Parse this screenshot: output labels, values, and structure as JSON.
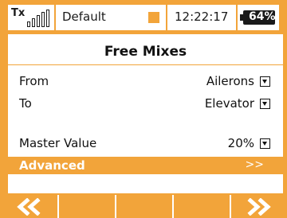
{
  "status_bar": {
    "tx_label": "Tx",
    "signal_icon": "signal-strength-icon",
    "model_name": "Default",
    "time": "12:22:17",
    "battery_percent": "64%",
    "battery_icon": "battery-icon"
  },
  "screen": {
    "title": "Free Mixes",
    "rows": [
      {
        "label": "From",
        "value": "Ailerons"
      },
      {
        "label": "To",
        "value": "Elevator"
      },
      {
        "label": "Master Value",
        "value": "20%"
      }
    ],
    "advanced": {
      "label": "Advanced",
      "arrow": ">>"
    }
  },
  "softkeys": {
    "left_icon": "double-chevron-left-icon",
    "right_icon": "double-chevron-right-icon"
  },
  "colors": {
    "accent": "#f2a43a",
    "text": "#111111",
    "background": "#ffffff"
  }
}
